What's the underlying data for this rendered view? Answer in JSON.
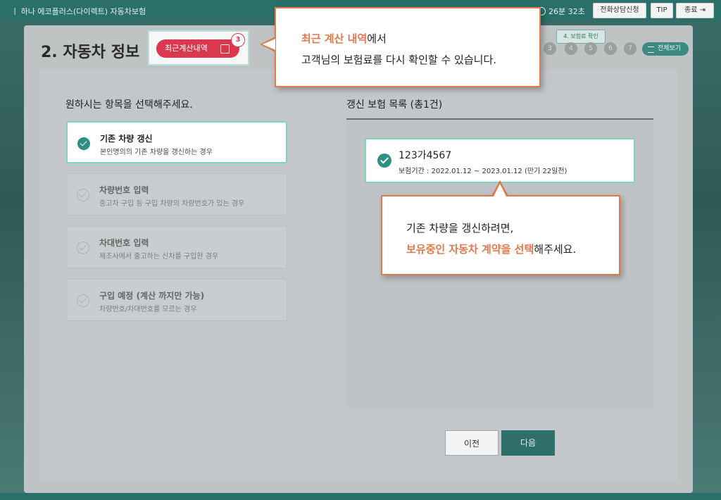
{
  "header": {
    "title": "ㅣ 하나 에코플러스(다이렉트) 자동차보험",
    "timer": "26분 32초",
    "buttons": [
      "전화상담신청",
      "TIP",
      "종료"
    ]
  },
  "page": {
    "title": "2. 자동차 정보",
    "recent_button": "최근계산내역",
    "recent_count": "3",
    "step_tip": "4. 보험료 확인",
    "steps": [
      "3",
      "4",
      "5",
      "6",
      "7"
    ],
    "view_all": "전체보기"
  },
  "left": {
    "heading": "원하시는 항목을 선택해주세요.",
    "options": [
      {
        "title": "기존 차량 갱신",
        "desc": "본인명의의 기존 차량을 갱신하는 경우",
        "selected": true
      },
      {
        "title": "차량번호 입력",
        "desc": "중고차 구입 등 구입 차량의 차량번호가 있는 경우",
        "selected": false
      },
      {
        "title": "차대번호 입력",
        "desc": "제조사에서 출고하는 신차를 구입한 경우",
        "selected": false
      },
      {
        "title": "구입 예정 (계산 까지만 가능)",
        "desc": "차량번호/차대번호를 모르는 경우",
        "selected": false
      }
    ]
  },
  "right": {
    "heading": "갱신 보험 목록 (총1건)",
    "item": {
      "plate": "123가4567",
      "period": "보험기간 : 2022.01.12 ~ 2023.01.12 (만기 22일전)"
    }
  },
  "nav": {
    "prev": "이전",
    "next": "다음"
  },
  "callouts": {
    "recent": {
      "highlight": "최근 계산 내역",
      "rest": "에서",
      "line2": "고객님의 보험료를 다시 확인할 수 있습니다."
    },
    "renew": {
      "line1": "기존 차량을 갱신하려면,",
      "highlight": "보유중인 자동차 계약을 선택",
      "rest": "해주세요."
    }
  },
  "colors": {
    "accent": "#2f8f82",
    "brand": "#d9384f",
    "callout": "#e07a4e",
    "topbar": "#2a6f69"
  }
}
